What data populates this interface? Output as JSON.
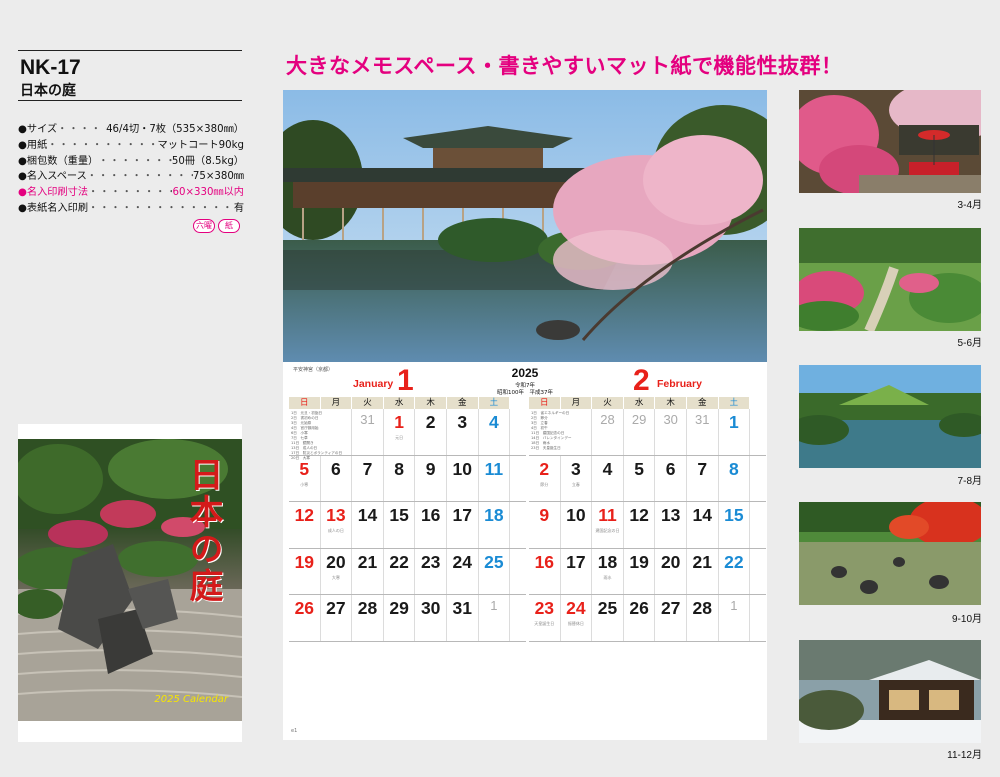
{
  "product": {
    "code": "NK-17",
    "name": "日本の庭"
  },
  "specs": [
    {
      "label": "●サイズ",
      "dots": "・・・・・・・・",
      "value": "46/4切・7枚（535×380㎜）",
      "highlight": false
    },
    {
      "label": "●用紙",
      "dots": "・・・・・・・・・・・・・・・・・・・・",
      "value": "マットコート90kg",
      "highlight": false
    },
    {
      "label": "●梱包数（重量）",
      "dots": "・・・・・・・・・・・・・・・・・・",
      "value": "50冊（8.5kg）",
      "highlight": false
    },
    {
      "label": "●名入スペース",
      "dots": "・・・・・・・・・・・・・・・・・・",
      "value": "75×380㎜",
      "highlight": false
    },
    {
      "label": "●名入印刷寸法",
      "dots": "・・・・・・・・・・・",
      "value": "60×330㎜以内",
      "highlight": true
    },
    {
      "label": "●表紙名入印刷",
      "dots": "・・・・・・・・・・・・・・・・・・・・・・・・・・",
      "value": "有",
      "highlight": false
    }
  ],
  "badges": [
    "六曜",
    "紙"
  ],
  "cover": {
    "title": "日本の庭",
    "subtitle": "2025 Calendar"
  },
  "headline": "大きなメモスペース・書きやすいマット紙で機能性抜群！",
  "calendar": {
    "note_top": "平安神宮（京都）",
    "year": "2025",
    "era1": "令和7年",
    "era2": "昭和100年　平成37年",
    "footer": "e1",
    "weekdays": [
      "日",
      "月",
      "火",
      "水",
      "木",
      "金",
      "土"
    ],
    "jan": {
      "num": "1",
      "name": "January",
      "notes": "1日　元旦・初詣日\n2日　書初めの日\n3日　元始祭\n4日　官庁御用始\n6日　小寒\n7日　七草\n11日　鏡開き\n13日　成人の日\n17日　防災とボランティアの日\n20日　大寒",
      "weeks": [
        [
          {
            "n": "",
            "t": "notes"
          },
          {
            "n": "",
            "t": "notes"
          },
          {
            "n": "31",
            "t": "prev"
          },
          {
            "n": "1",
            "t": "hol",
            "s": "元日"
          },
          {
            "n": "2",
            "t": "",
            "s": ""
          },
          {
            "n": "3",
            "t": "",
            "s": ""
          },
          {
            "n": "4",
            "t": "sat",
            "s": ""
          }
        ],
        [
          {
            "n": "5",
            "t": "sun",
            "s": "小寒"
          },
          {
            "n": "6",
            "t": ""
          },
          {
            "n": "7",
            "t": ""
          },
          {
            "n": "8",
            "t": ""
          },
          {
            "n": "9",
            "t": ""
          },
          {
            "n": "10",
            "t": ""
          },
          {
            "n": "11",
            "t": "sat"
          }
        ],
        [
          {
            "n": "12",
            "t": "sun"
          },
          {
            "n": "13",
            "t": "hol",
            "s": "成人の日"
          },
          {
            "n": "14",
            "t": ""
          },
          {
            "n": "15",
            "t": ""
          },
          {
            "n": "16",
            "t": ""
          },
          {
            "n": "17",
            "t": ""
          },
          {
            "n": "18",
            "t": "sat"
          }
        ],
        [
          {
            "n": "19",
            "t": "sun"
          },
          {
            "n": "20",
            "t": "",
            "s": "大寒"
          },
          {
            "n": "21",
            "t": ""
          },
          {
            "n": "22",
            "t": ""
          },
          {
            "n": "23",
            "t": ""
          },
          {
            "n": "24",
            "t": ""
          },
          {
            "n": "25",
            "t": "sat"
          }
        ],
        [
          {
            "n": "26",
            "t": "sun"
          },
          {
            "n": "27",
            "t": ""
          },
          {
            "n": "28",
            "t": ""
          },
          {
            "n": "29",
            "t": ""
          },
          {
            "n": "30",
            "t": ""
          },
          {
            "n": "31",
            "t": ""
          },
          {
            "n": "1",
            "t": "prev"
          }
        ]
      ]
    },
    "feb": {
      "num": "2",
      "name": "February",
      "notes": "1日　省エネルギーの日\n2日　節分\n3日　立春\n4日　初午\n11日　建国記念の日\n14日　バレンタインデー\n18日　雨水\n23日　天皇誕生日",
      "weeks": [
        [
          {
            "n": "",
            "t": "notes"
          },
          {
            "n": "",
            "t": "notes"
          },
          {
            "n": "28",
            "t": "prev"
          },
          {
            "n": "29",
            "t": "prev"
          },
          {
            "n": "30",
            "t": "prev"
          },
          {
            "n": "31",
            "t": "prev"
          },
          {
            "n": "1",
            "t": "sat"
          }
        ],
        [
          {
            "n": "2",
            "t": "sun",
            "s": "節分"
          },
          {
            "n": "3",
            "t": "",
            "s": "立春"
          },
          {
            "n": "4",
            "t": ""
          },
          {
            "n": "5",
            "t": ""
          },
          {
            "n": "6",
            "t": ""
          },
          {
            "n": "7",
            "t": ""
          },
          {
            "n": "8",
            "t": "sat"
          }
        ],
        [
          {
            "n": "9",
            "t": "sun"
          },
          {
            "n": "10",
            "t": ""
          },
          {
            "n": "11",
            "t": "hol",
            "s": "建国記念の日"
          },
          {
            "n": "12",
            "t": ""
          },
          {
            "n": "13",
            "t": ""
          },
          {
            "n": "14",
            "t": ""
          },
          {
            "n": "15",
            "t": "sat"
          }
        ],
        [
          {
            "n": "16",
            "t": "sun"
          },
          {
            "n": "17",
            "t": ""
          },
          {
            "n": "18",
            "t": "",
            "s": "雨水"
          },
          {
            "n": "19",
            "t": ""
          },
          {
            "n": "20",
            "t": ""
          },
          {
            "n": "21",
            "t": ""
          },
          {
            "n": "22",
            "t": "sat"
          }
        ],
        [
          {
            "n": "23",
            "t": "sun",
            "s": "天皇誕生日"
          },
          {
            "n": "24",
            "t": "hol",
            "s": "振替休日"
          },
          {
            "n": "25",
            "t": ""
          },
          {
            "n": "26",
            "t": ""
          },
          {
            "n": "27",
            "t": ""
          },
          {
            "n": "28",
            "t": ""
          },
          {
            "n": "1",
            "t": "prev"
          }
        ]
      ]
    }
  },
  "thumbnails": [
    {
      "label": "3-4月",
      "scene": "azalea-teahouse"
    },
    {
      "label": "5-6月",
      "scene": "clipped-shrubs"
    },
    {
      "label": "7-8月",
      "scene": "pond-garden"
    },
    {
      "label": "9-10月",
      "scene": "rock-garden"
    },
    {
      "label": "11-12月",
      "scene": "snow-villa"
    }
  ],
  "colors": {
    "accent": "#e4007f",
    "sunday": "#e8211a",
    "saturday": "#1a8bd4"
  }
}
